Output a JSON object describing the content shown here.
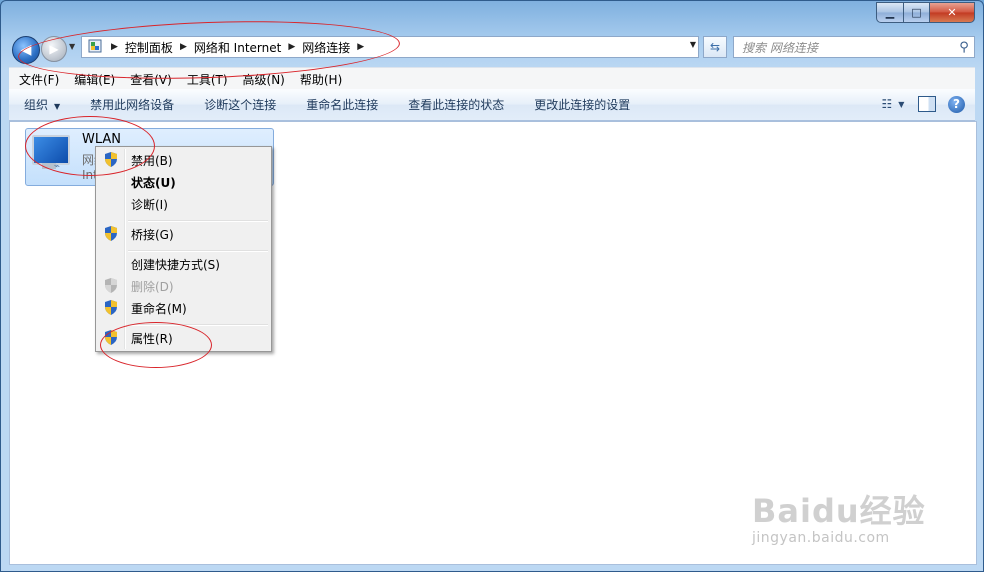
{
  "window": {
    "caption_buttons": {
      "minimize": "▁",
      "maximize": "□",
      "close": "✕"
    }
  },
  "nav": {
    "breadcrumbs": [
      "控制面板",
      "网络和 Internet",
      "网络连接"
    ],
    "search_placeholder": "搜索 网络连接"
  },
  "menubar": {
    "items": [
      "文件(F)",
      "编辑(E)",
      "查看(V)",
      "工具(T)",
      "高级(N)",
      "帮助(H)"
    ]
  },
  "commandbar": {
    "items": [
      "组织",
      "禁用此网络设备",
      "诊断这个连接",
      "重命名此连接",
      "查看此连接的状态",
      "更改此连接的设置"
    ],
    "help": "?"
  },
  "connection": {
    "name": "WLAN",
    "line2": "网络",
    "line3": "Internet"
  },
  "context_menu": {
    "items": [
      {
        "label": "禁用(B)",
        "shield": true,
        "bold": false,
        "disabled": false
      },
      {
        "label": "状态(U)",
        "shield": false,
        "bold": true,
        "disabled": false
      },
      {
        "label": "诊断(I)",
        "shield": false,
        "bold": false,
        "disabled": false
      },
      {
        "label": "桥接(G)",
        "shield": true,
        "bold": false,
        "disabled": false
      },
      {
        "label": "创建快捷方式(S)",
        "shield": false,
        "bold": false,
        "disabled": false
      },
      {
        "label": "删除(D)",
        "shield": true,
        "bold": false,
        "disabled": true
      },
      {
        "label": "重命名(M)",
        "shield": true,
        "bold": false,
        "disabled": false
      },
      {
        "label": "属性(R)",
        "shield": true,
        "bold": false,
        "disabled": false
      }
    ]
  },
  "watermark": {
    "main": "Baidu经验",
    "sub": "jingyan.baidu.com"
  },
  "colors": {
    "annotation": "#d9252b",
    "accent": "#1e395b"
  }
}
